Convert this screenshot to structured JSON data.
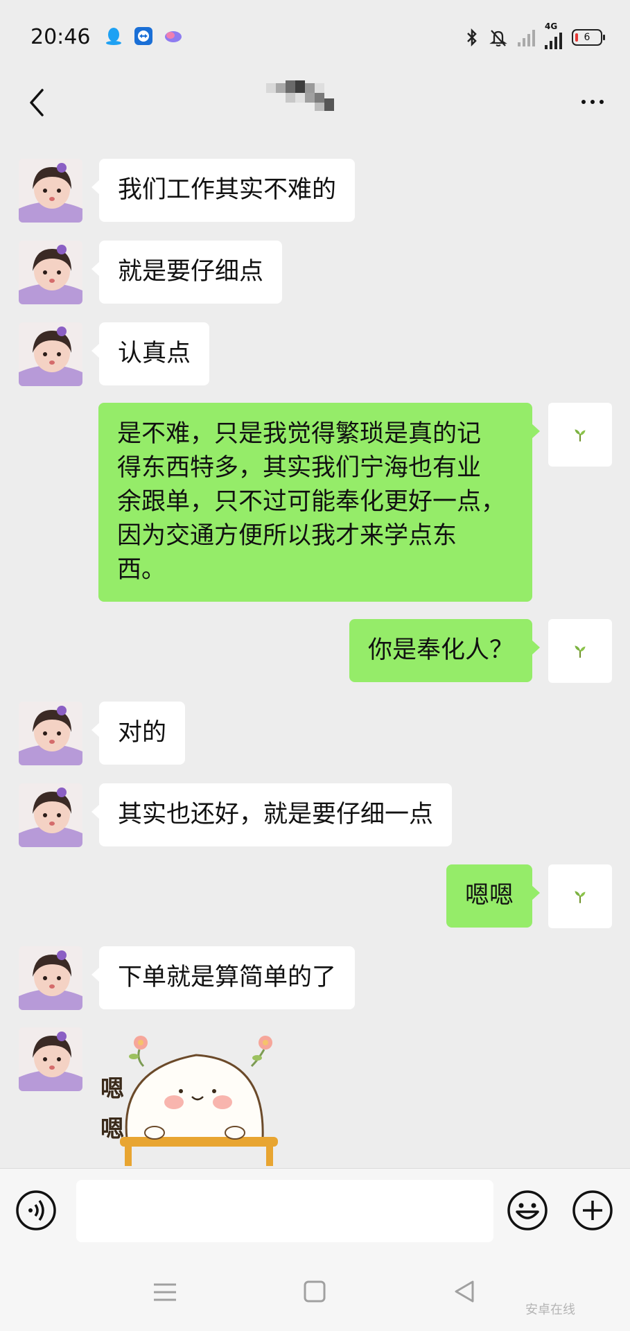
{
  "status_bar": {
    "time": "20:46",
    "icons": [
      "qq-icon",
      "teamviewer-icon",
      "cloud-app-icon",
      "bluetooth-icon",
      "mute-bell-icon",
      "signal-icon",
      "4g-signal-icon",
      "battery-icon"
    ],
    "network_label": "4G",
    "battery_level": "6"
  },
  "header": {
    "title": "",
    "title_state": "pixelated"
  },
  "messages": [
    {
      "side": "left",
      "text": "我们工作其实不难的"
    },
    {
      "side": "left",
      "text": "就是要仔细点"
    },
    {
      "side": "left",
      "text": "认真点"
    },
    {
      "side": "right",
      "lines": [
        "是不难，只是我觉得繁琐是真的记",
        "得东西特多，其实我们宁海也有业",
        "余跟单，只不过可能奉化更好一点，",
        "因为交通方便所以我才来学点东",
        "西。"
      ]
    },
    {
      "side": "right",
      "text": "你是奉化人？"
    },
    {
      "side": "left",
      "text": "对的"
    },
    {
      "side": "left",
      "text": "其实也还好，就是要仔细一点"
    },
    {
      "side": "right",
      "text": "嗯嗯"
    },
    {
      "side": "left",
      "text": "下单就是算简单的了"
    },
    {
      "side": "left",
      "type": "sticker",
      "sticker_text": [
        "嗯",
        "嗯"
      ]
    }
  ],
  "input_bar": {
    "placeholder": "",
    "icons": [
      "voice-icon",
      "emoji-icon",
      "plus-icon"
    ]
  },
  "nav_bar": {
    "icons": [
      "menu-icon",
      "home-icon",
      "back-icon"
    ],
    "watermark": "安卓在线"
  },
  "colors": {
    "background": "#ededed",
    "bubble_in": "#ffffff",
    "bubble_out": "#95ec69"
  }
}
